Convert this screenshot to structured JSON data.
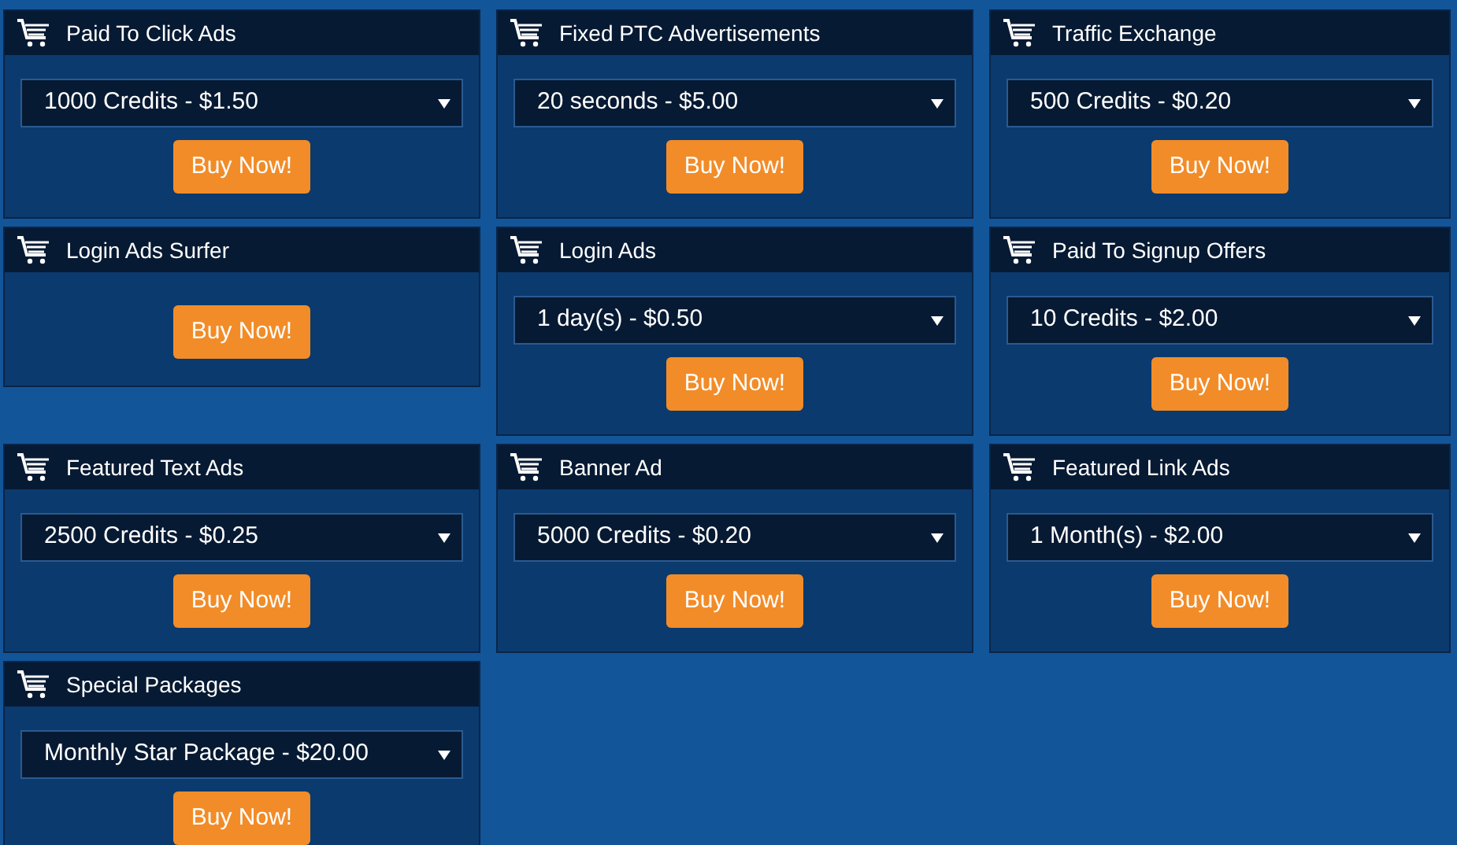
{
  "packages": [
    {
      "title": "Paid To Click Ads",
      "option": "1000 Credits - $1.50",
      "button": "Buy Now!"
    },
    {
      "title": "Fixed PTC Advertisements",
      "option": "20 seconds - $5.00",
      "button": "Buy Now!"
    },
    {
      "title": "Traffic Exchange",
      "option": "500 Credits - $0.20",
      "button": "Buy Now!"
    },
    {
      "title": "Login Ads Surfer",
      "button": "Buy Now!"
    },
    {
      "title": "Login Ads",
      "option": "1 day(s) - $0.50",
      "button": "Buy Now!"
    },
    {
      "title": "Paid To Signup Offers",
      "option": "10 Credits - $2.00",
      "button": "Buy Now!"
    },
    {
      "title": "Featured Text Ads",
      "option": "2500 Credits - $0.25",
      "button": "Buy Now!"
    },
    {
      "title": "Banner Ad",
      "option": "5000 Credits - $0.20",
      "button": "Buy Now!"
    },
    {
      "title": "Featured Link Ads",
      "option": "1 Month(s) - $2.00",
      "button": "Buy Now!"
    },
    {
      "title": "Special Packages",
      "option": "Monthly Star Package - $20.00",
      "button": "Buy Now!"
    }
  ]
}
